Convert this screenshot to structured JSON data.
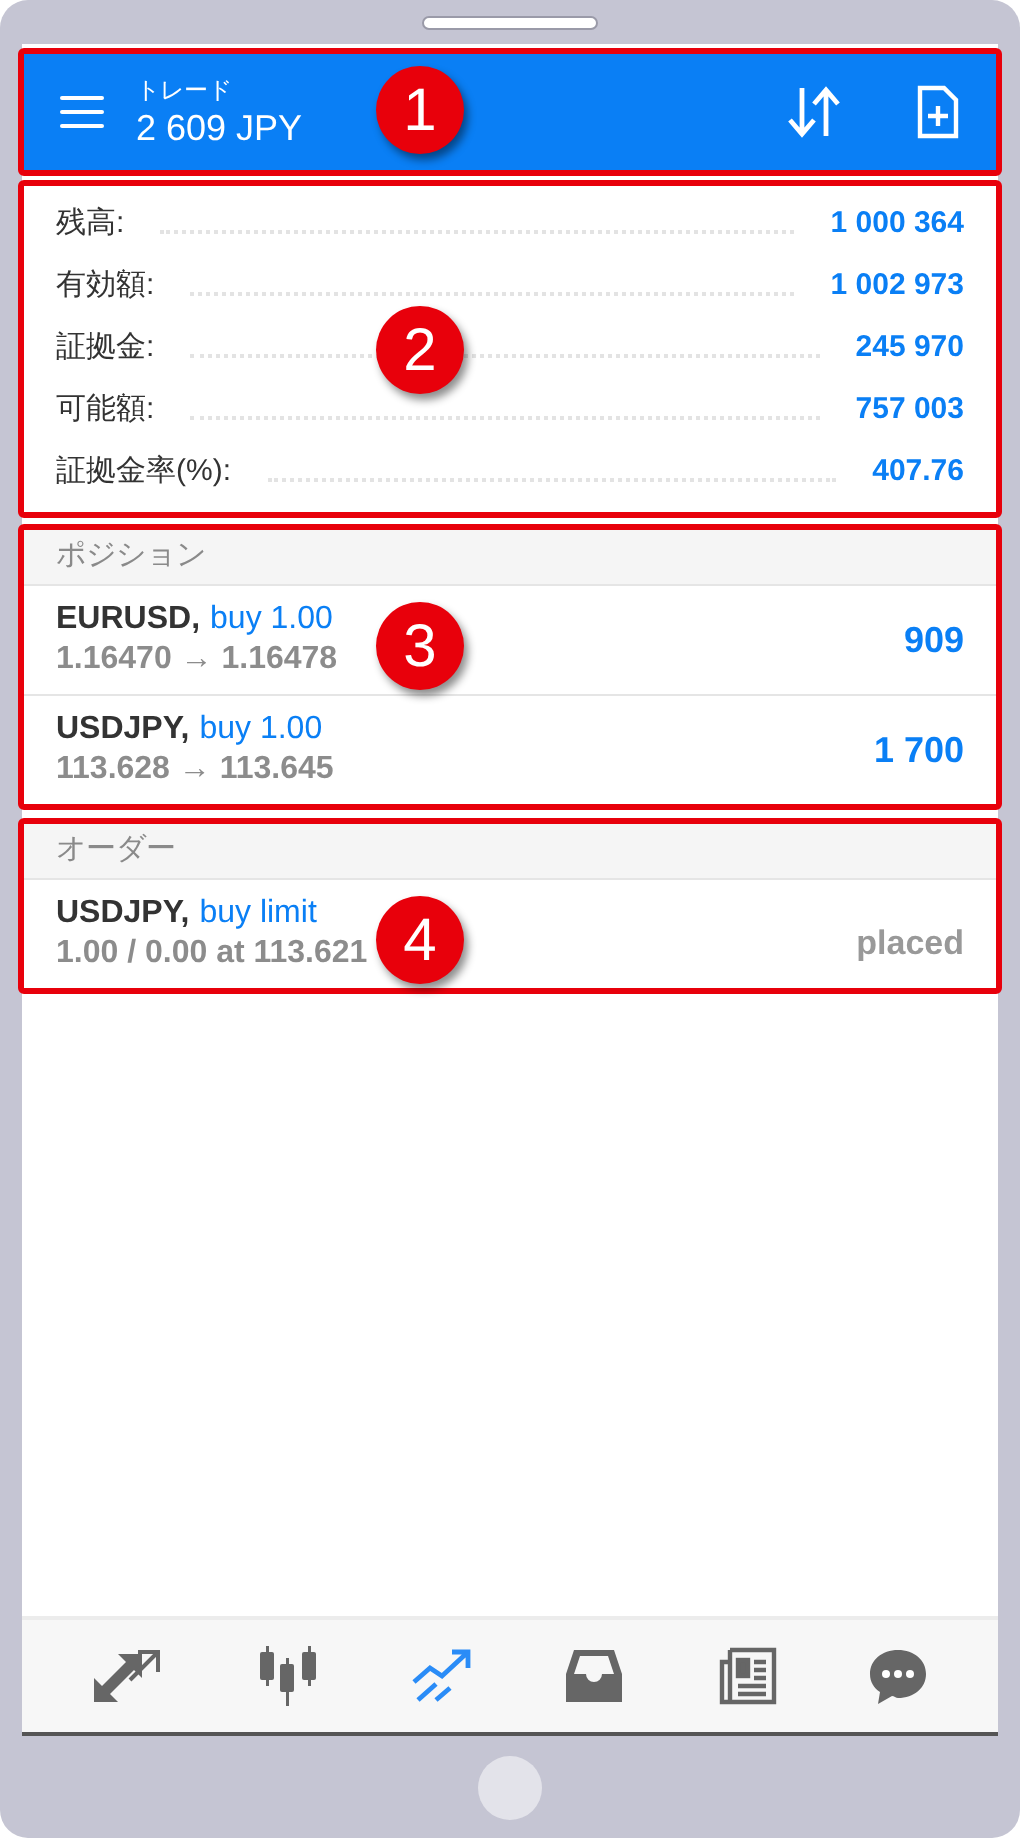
{
  "header": {
    "title": "トレード",
    "balance": "2 609 JPY",
    "callout": "1"
  },
  "summary": {
    "callout": "2",
    "rows": [
      {
        "label": "残高:",
        "value": "1 000 364"
      },
      {
        "label": "有効額:",
        "value": "1 002 973"
      },
      {
        "label": "証拠金:",
        "value": "245 970"
      },
      {
        "label": "可能額:",
        "value": "757 003"
      },
      {
        "label": "証拠金率(%):",
        "value": "407.76"
      }
    ]
  },
  "positions": {
    "title": "ポジション",
    "callout": "3",
    "rows": [
      {
        "symbol": "EURUSD,",
        "type": "buy 1.00",
        "prices": "1.16470 → 1.16478",
        "profit": "909"
      },
      {
        "symbol": "USDJPY,",
        "type": "buy 1.00",
        "prices": "113.628 → 113.645",
        "profit": "1 700"
      }
    ]
  },
  "orders": {
    "title": "オーダー",
    "callout": "4",
    "rows": [
      {
        "symbol": "USDJPY,",
        "type": "buy limit",
        "details": "1.00 / 0.00 at 113.621",
        "status": "placed"
      }
    ]
  },
  "nav": {
    "items": [
      {
        "selected": false
      },
      {
        "selected": false
      },
      {
        "selected": true
      },
      {
        "selected": false
      },
      {
        "selected": false
      },
      {
        "selected": false
      }
    ]
  }
}
